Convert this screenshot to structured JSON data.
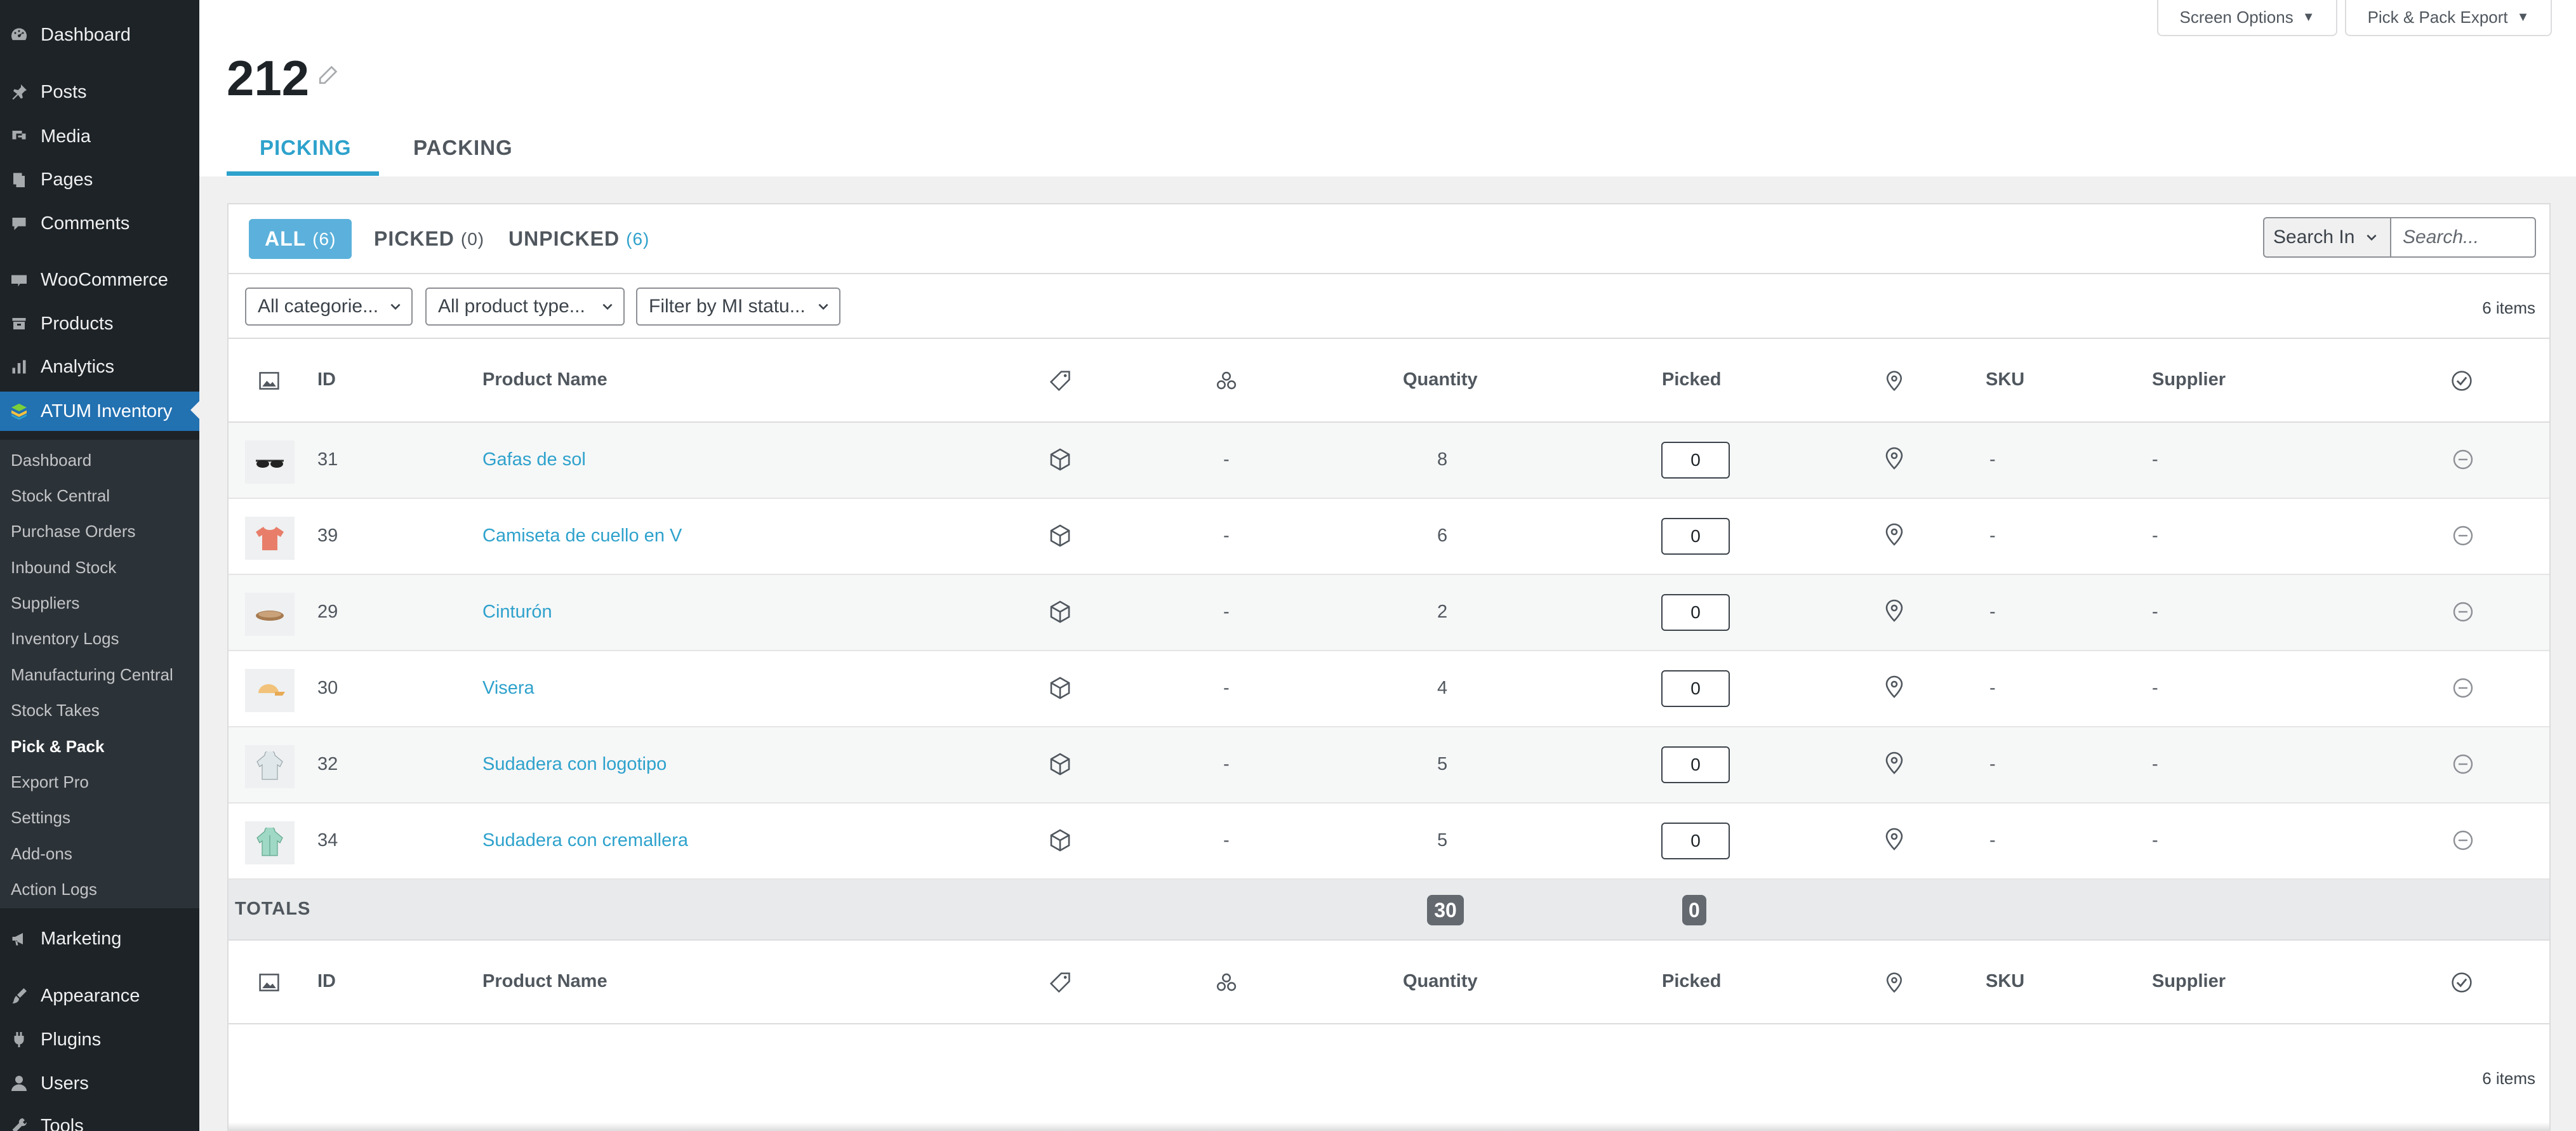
{
  "sidebar": {
    "items": [
      {
        "label": "Dashboard",
        "icon": "dashboard-icon"
      },
      {
        "label": "Posts",
        "icon": "pin-icon"
      },
      {
        "label": "Media",
        "icon": "media-icon"
      },
      {
        "label": "Pages",
        "icon": "pages-icon"
      },
      {
        "label": "Comments",
        "icon": "comments-icon"
      },
      {
        "label": "WooCommerce",
        "icon": "woocommerce-icon"
      },
      {
        "label": "Products",
        "icon": "products-icon"
      },
      {
        "label": "Analytics",
        "icon": "analytics-icon"
      },
      {
        "label": "ATUM Inventory",
        "icon": "atum-icon",
        "active": true
      },
      {
        "label": "Marketing",
        "icon": "megaphone-icon"
      },
      {
        "label": "Appearance",
        "icon": "brush-icon"
      },
      {
        "label": "Plugins",
        "icon": "plugin-icon"
      },
      {
        "label": "Users",
        "icon": "users-icon"
      },
      {
        "label": "Tools",
        "icon": "tools-icon"
      }
    ],
    "submenu": [
      {
        "label": "Dashboard"
      },
      {
        "label": "Stock Central"
      },
      {
        "label": "Purchase Orders"
      },
      {
        "label": "Inbound Stock"
      },
      {
        "label": "Suppliers"
      },
      {
        "label": "Inventory Logs"
      },
      {
        "label": "Manufacturing Central"
      },
      {
        "label": "Stock Takes"
      },
      {
        "label": "Pick & Pack",
        "current": true
      },
      {
        "label": "Export Pro"
      },
      {
        "label": "Settings"
      },
      {
        "label": "Add-ons"
      },
      {
        "label": "Action Logs"
      }
    ]
  },
  "header": {
    "screen_options": "Screen Options",
    "export_button": "Pick & Pack Export",
    "title": "212",
    "tabs": [
      {
        "label": "PICKING",
        "active": true
      },
      {
        "label": "PACKING",
        "active": false
      }
    ]
  },
  "filters": {
    "views": [
      {
        "label": "ALL",
        "count": "(6)",
        "active": true
      },
      {
        "label": "PICKED",
        "count": "(0)"
      },
      {
        "label": "UNPICKED",
        "count": "(6)"
      }
    ],
    "search_in": "Search In",
    "search_placeholder": "Search...",
    "category_select": "All categorie...",
    "type_select": "All product type...",
    "mi_select": "Filter by MI statu...",
    "items_count": "6 items"
  },
  "table": {
    "columns": {
      "id": "ID",
      "name": "Product Name",
      "quantity": "Quantity",
      "picked": "Picked",
      "sku": "SKU",
      "supplier": "Supplier"
    },
    "rows": [
      {
        "id": "31",
        "name": "Gafas de sol",
        "bom": "-",
        "quantity": "8",
        "picked": "0",
        "sku": "-",
        "supplier": "-",
        "thumb": "sunglasses-thumbnail"
      },
      {
        "id": "39",
        "name": "Camiseta de cuello en V",
        "bom": "-",
        "quantity": "6",
        "picked": "0",
        "sku": "-",
        "supplier": "-",
        "thumb": "tshirt-thumbnail"
      },
      {
        "id": "29",
        "name": "Cinturón",
        "bom": "-",
        "quantity": "2",
        "picked": "0",
        "sku": "-",
        "supplier": "-",
        "thumb": "belt-thumbnail"
      },
      {
        "id": "30",
        "name": "Visera",
        "bom": "-",
        "quantity": "4",
        "picked": "0",
        "sku": "-",
        "supplier": "-",
        "thumb": "cap-thumbnail"
      },
      {
        "id": "32",
        "name": "Sudadera con logotipo",
        "bom": "-",
        "quantity": "5",
        "picked": "0",
        "sku": "-",
        "supplier": "-",
        "thumb": "hoodie-thumbnail"
      },
      {
        "id": "34",
        "name": "Sudadera con cremallera",
        "bom": "-",
        "quantity": "5",
        "picked": "0",
        "sku": "-",
        "supplier": "-",
        "thumb": "zip-hoodie-thumbnail"
      }
    ],
    "totals": {
      "label": "TOTALS",
      "quantity": "30",
      "picked": "0"
    },
    "footer_count": "6 items"
  },
  "colors": {
    "sidebar_bg": "#1d2327",
    "accent_blue": "#2271b1",
    "link_blue": "#2ea2cc",
    "pill_blue": "#5bb1db",
    "badge_gray": "#646970"
  }
}
